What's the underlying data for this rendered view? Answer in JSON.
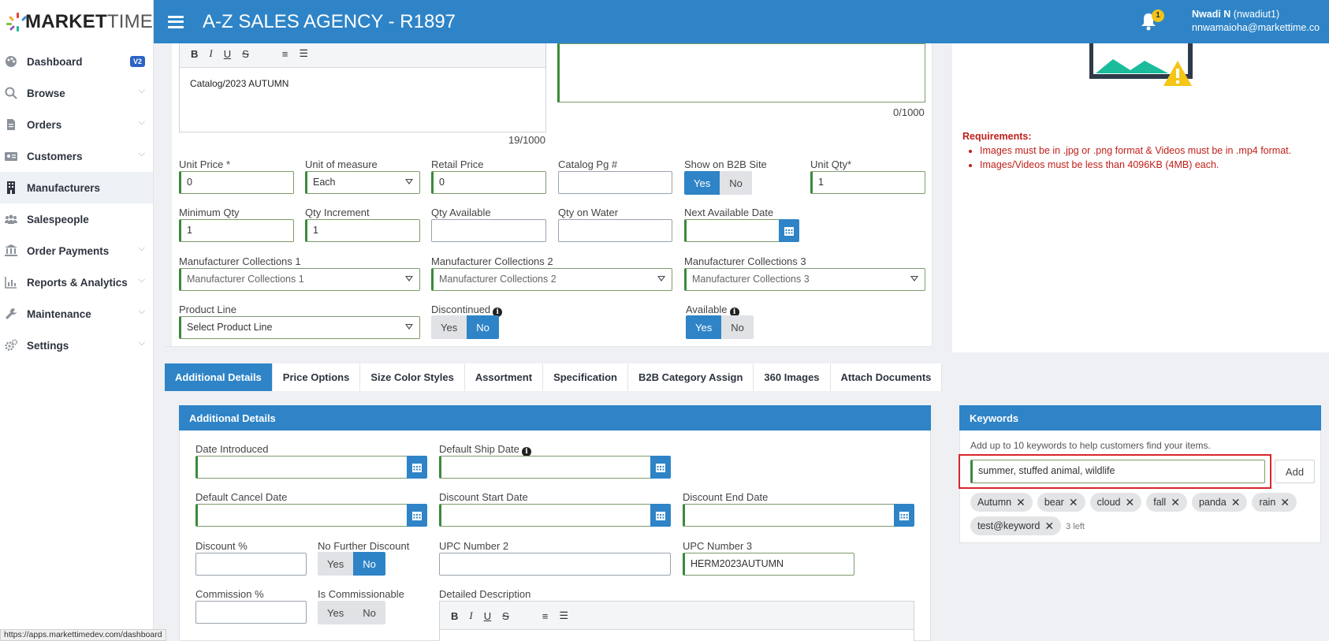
{
  "brand": {
    "logo_bold": "MARKET",
    "logo_light": "TIME"
  },
  "header": {
    "title": "A-Z SALES AGENCY - R1897",
    "notification_count": "1",
    "user_name": "Nwadi N",
    "user_handle": "(nwadiut1)",
    "user_email": "nnwamaioha@markettime.co"
  },
  "sidebar": {
    "items": [
      {
        "label": "Dashboard",
        "icon": "palette-icon",
        "badge": "V2"
      },
      {
        "label": "Browse",
        "icon": "search-icon"
      },
      {
        "label": "Orders",
        "icon": "document-icon"
      },
      {
        "label": "Customers",
        "icon": "id-card-icon"
      },
      {
        "label": "Manufacturers",
        "icon": "building-icon",
        "active": true
      },
      {
        "label": "Salespeople",
        "icon": "users-icon"
      },
      {
        "label": "Order Payments",
        "icon": "bank-icon"
      },
      {
        "label": "Reports & Analytics",
        "icon": "chart-icon"
      },
      {
        "label": "Maintenance",
        "icon": "wrench-icon"
      },
      {
        "label": "Settings",
        "icon": "gears-icon"
      }
    ]
  },
  "top_form": {
    "catalog_text": "Catalog/2023 AUTUMN",
    "catalog_count": "19/1000",
    "notes_count": "0/1000",
    "unit_price": {
      "label": "Unit Price *",
      "value": "0"
    },
    "unit_of_measure": {
      "label": "Unit of measure",
      "value": "Each"
    },
    "retail_price": {
      "label": "Retail Price",
      "value": "0"
    },
    "catalog_pg": {
      "label": "Catalog Pg #",
      "value": ""
    },
    "show_b2b": {
      "label": "Show on B2B Site",
      "yes": "Yes",
      "no": "No",
      "selected": "Yes"
    },
    "unit_qty": {
      "label": "Unit Qty*",
      "value": "1"
    },
    "min_qty": {
      "label": "Minimum Qty",
      "value": "1"
    },
    "qty_increment": {
      "label": "Qty Increment",
      "value": "1"
    },
    "qty_available": {
      "label": "Qty Available",
      "value": ""
    },
    "qty_on_water": {
      "label": "Qty on Water",
      "value": ""
    },
    "next_available": {
      "label": "Next Available Date",
      "value": ""
    },
    "collections1": {
      "label": "Manufacturer Collections 1",
      "value": "Manufacturer Collections 1"
    },
    "collections2": {
      "label": "Manufacturer Collections 2",
      "value": "Manufacturer Collections 2"
    },
    "collections3": {
      "label": "Manufacturer Collections 3",
      "value": "Manufacturer Collections 3"
    },
    "product_line": {
      "label": "Product Line",
      "value": "Select Product Line"
    },
    "discontinued": {
      "label": "Discontinued",
      "yes": "Yes",
      "no": "No",
      "selected": "No"
    },
    "available": {
      "label": "Available",
      "yes": "Yes",
      "no": "No",
      "selected": "Yes"
    }
  },
  "requirements": {
    "title": "Requirements:",
    "items": [
      "Images must be in .jpg or .png format & Videos must be in .mp4 format.",
      "Images/Videos must be less than 4096KB (4MB) each."
    ]
  },
  "tabs": [
    "Additional Details",
    "Price Options",
    "Size Color Styles",
    "Assortment",
    "Specification",
    "B2B Category Assign",
    "360 Images",
    "Attach Documents"
  ],
  "additional_details": {
    "title": "Additional Details",
    "date_introduced": {
      "label": "Date Introduced",
      "value": ""
    },
    "default_ship_date": {
      "label": "Default Ship Date",
      "value": ""
    },
    "default_cancel_date": {
      "label": "Default Cancel Date",
      "value": ""
    },
    "discount_start": {
      "label": "Discount Start Date",
      "value": ""
    },
    "discount_end": {
      "label": "Discount End Date",
      "value": ""
    },
    "discount_pct": {
      "label": "Discount %",
      "value": ""
    },
    "no_further_discount": {
      "label": "No Further Discount",
      "yes": "Yes",
      "no": "No",
      "selected": "No"
    },
    "upc2": {
      "label": "UPC Number 2",
      "value": ""
    },
    "upc3": {
      "label": "UPC Number 3",
      "value": "HERM2023AUTUMN"
    },
    "commission_pct": {
      "label": "Commission %",
      "value": ""
    },
    "is_commissionable": {
      "label": "Is Commissionable",
      "yes": "Yes",
      "no": "No",
      "selected": ""
    },
    "detailed_description": {
      "label": "Detailed Description"
    }
  },
  "keywords": {
    "title": "Keywords",
    "hint": "Add up to 10 keywords to help customers find your items.",
    "input_value": "summer, stuffed animal, wildlife",
    "add_label": "Add",
    "chips": [
      "Autumn",
      "bear",
      "cloud",
      "fall",
      "panda",
      "rain",
      "test@keyword"
    ],
    "remaining": "3 left"
  },
  "status_bar_url": "https://apps.markettimedev.com/dashboard",
  "colors": {
    "accent": "#2e84c7",
    "valid_border": "#3a8a3a",
    "error": "#c0201a"
  }
}
